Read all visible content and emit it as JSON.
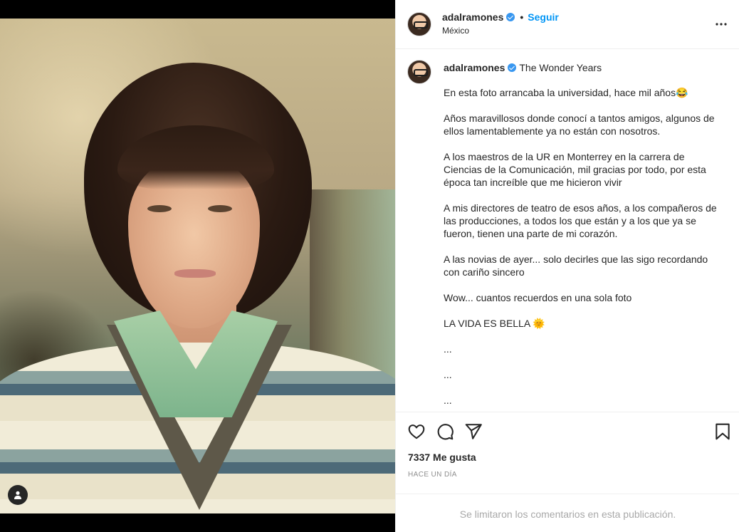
{
  "post": {
    "username": "adalramones",
    "follow_label": "Seguir",
    "location": "México",
    "separator": "•",
    "more_icon": "more-horizontal-icon"
  },
  "caption": {
    "username": "adalramones",
    "title": "The Wonder Years",
    "paragraphs": [
      "En esta foto arrancaba la universidad, hace mil años😂",
      "Años maravillosos donde conocí a tantos amigos, algunos de ellos lamentablemente ya no están con nosotros.",
      "A los maestros de la UR en Monterrey en la carrera de Ciencias de la Comunicación, mil gracias por todo, por esta época tan increíble que me hicieron vivir",
      "A mis directores de teatro de esos años, a los compañeros de las producciones, a todos los que están y a los que ya se fueron, tienen una parte de mi corazón.",
      "A las novias de ayer... solo decirles que las sigo recordando con cariño sincero",
      "Wow... cuantos recuerdos en una sola foto",
      "LA VIDA ES BELLA 🌞",
      "...",
      "...",
      "..."
    ]
  },
  "actions": {
    "likes_text": "7337 Me gusta",
    "time_ago": "HACE UN DÍA",
    "icons": [
      "heart-icon",
      "comment-icon",
      "share-icon",
      "bookmark-icon"
    ]
  },
  "comments": {
    "limited_text": "Se limitaron los comentarios en esta publicación."
  },
  "colors": {
    "link_blue": "#0095f6",
    "verified_blue": "#3897f0",
    "text": "#262626",
    "muted": "#8e8e8e",
    "border": "#efefef"
  }
}
